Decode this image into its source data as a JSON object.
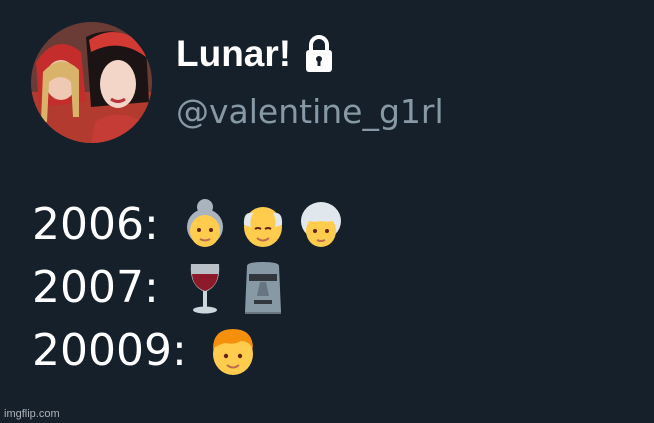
{
  "profile": {
    "display_name": "Lunar!",
    "handle": "@valentine_g1rl",
    "protected_icon": "lock-icon",
    "avatar": "avatar-photo"
  },
  "tweet": {
    "lines": [
      {
        "year": "2006:",
        "emojis": [
          "older-woman-emoji",
          "older-man-emoji",
          "older-person-emoji"
        ]
      },
      {
        "year": "2007:",
        "emojis": [
          "wine-glass-emoji",
          "moai-emoji"
        ]
      },
      {
        "year": "20009:",
        "emojis": [
          "boy-emoji"
        ]
      }
    ]
  },
  "watermark": "imgflip.com",
  "colors": {
    "background": "#15202b",
    "name": "#ffffff",
    "handle": "#8899a6",
    "text": "#ffffff"
  }
}
